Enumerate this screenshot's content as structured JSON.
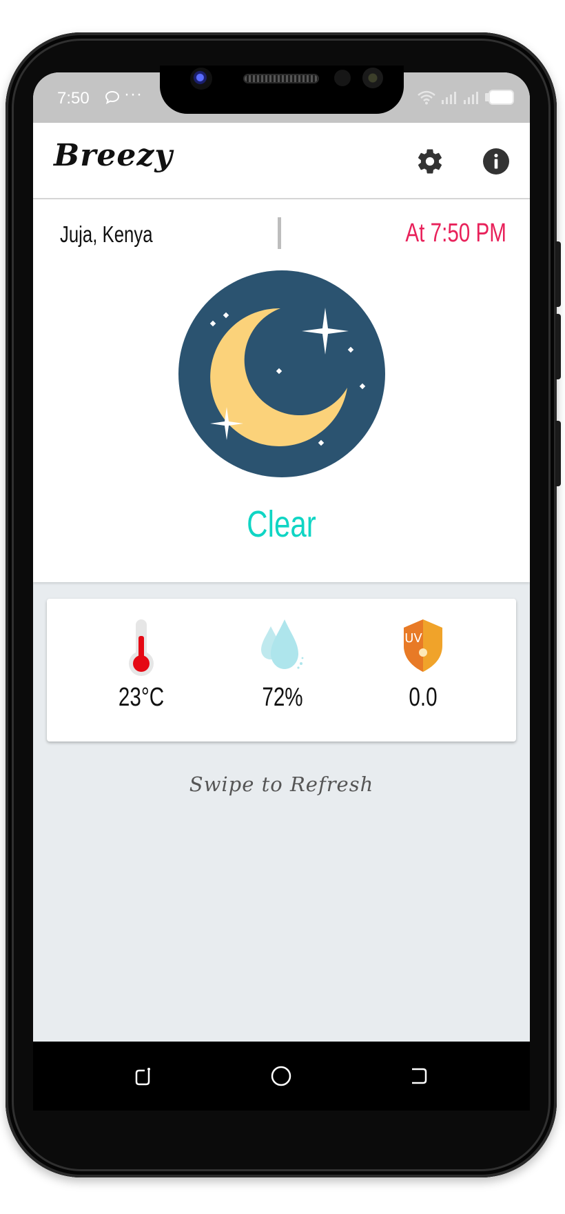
{
  "status_bar": {
    "time": "7:50",
    "dots": "···"
  },
  "app_bar": {
    "title": "Breezy",
    "settings_icon": "gear-icon",
    "info_icon": "info-icon"
  },
  "weather": {
    "location": "Juja, Kenya",
    "updated_at": "At 7:50 PM",
    "condition": "Clear",
    "condition_icon": "moon-stars-icon",
    "condition_color": "#10d5c4",
    "updated_color": "#e8215a"
  },
  "stats": {
    "temperature": "23°C",
    "humidity": "72%",
    "uv_index": "0.0",
    "uv_badge": "UV"
  },
  "refresh_hint": "Swipe to Refresh",
  "nav": {
    "recent_icon": "recent-apps-icon",
    "home_icon": "home-icon",
    "back_icon": "back-icon"
  }
}
